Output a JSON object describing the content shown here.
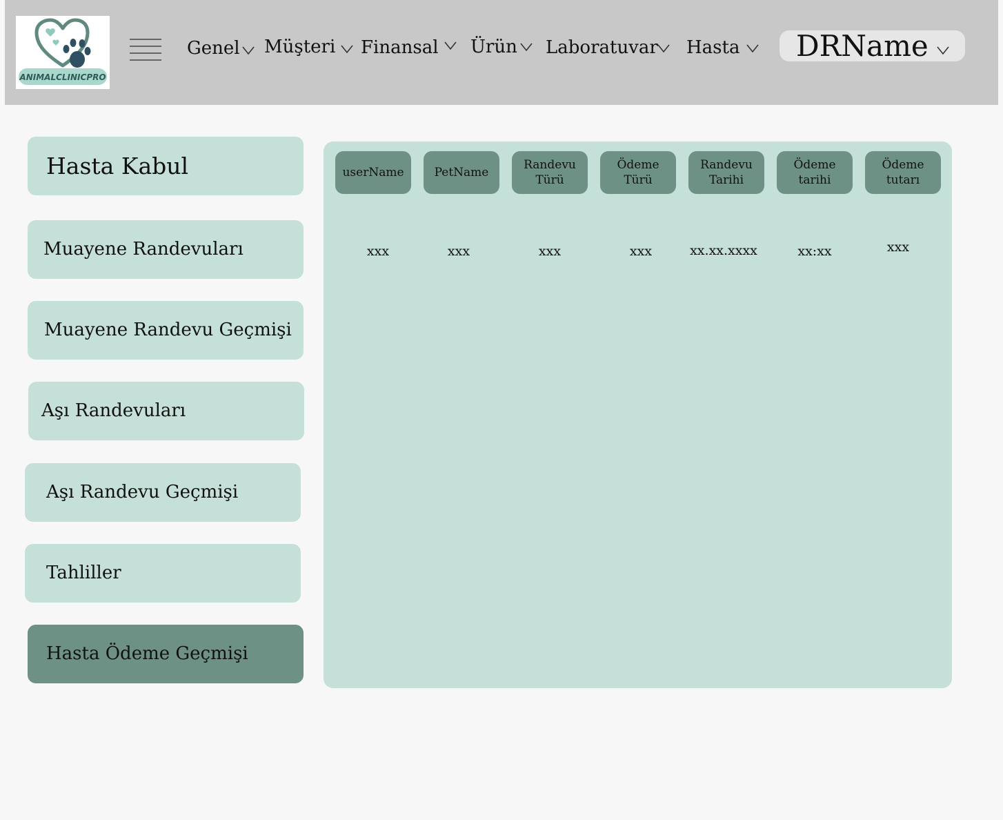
{
  "header": {
    "logo_text": "ANIMALCLINICPRO",
    "menu_icon": "hamburger-menu-icon",
    "nav": [
      {
        "label": "Genel"
      },
      {
        "label": "Müşteri"
      },
      {
        "label": "Finansal"
      },
      {
        "label": "Ürün"
      },
      {
        "label": "Laboratuvar"
      },
      {
        "label": "Hasta"
      }
    ],
    "user": {
      "name": "DRName"
    }
  },
  "sidebar": {
    "items": [
      {
        "label": "Hasta Kabul"
      },
      {
        "label": "Muayene Randevuları"
      },
      {
        "label": "Muayene Randevu Geçmişi"
      },
      {
        "label": "Aşı Randevuları"
      },
      {
        "label": "Aşı Randevu Geçmişi"
      },
      {
        "label": "Tahliller"
      },
      {
        "label": "Hasta Ödeme Geçmişi",
        "active": true
      }
    ]
  },
  "table": {
    "columns": [
      {
        "line1": "userName",
        "line2": ""
      },
      {
        "line1": "PetName",
        "line2": ""
      },
      {
        "line1": "Randevu",
        "line2": "Türü"
      },
      {
        "line1": "Ödeme",
        "line2": "Türü"
      },
      {
        "line1": "Randevu",
        "line2": "Tarihi"
      },
      {
        "line1": "Ödeme",
        "line2": "tarihi"
      },
      {
        "line1": "Ödeme",
        "line2": "tutarı"
      }
    ],
    "rows": [
      [
        "xxx",
        "xxx",
        "xxx",
        "xxx",
        "xx.xx.xxxx",
        "xx:xx",
        "xxx"
      ]
    ]
  },
  "colors": {
    "topbar": "#c8c8c8",
    "panel": "#c5e0d8",
    "accent": "#6d9184",
    "background": "#f7f7f7"
  }
}
